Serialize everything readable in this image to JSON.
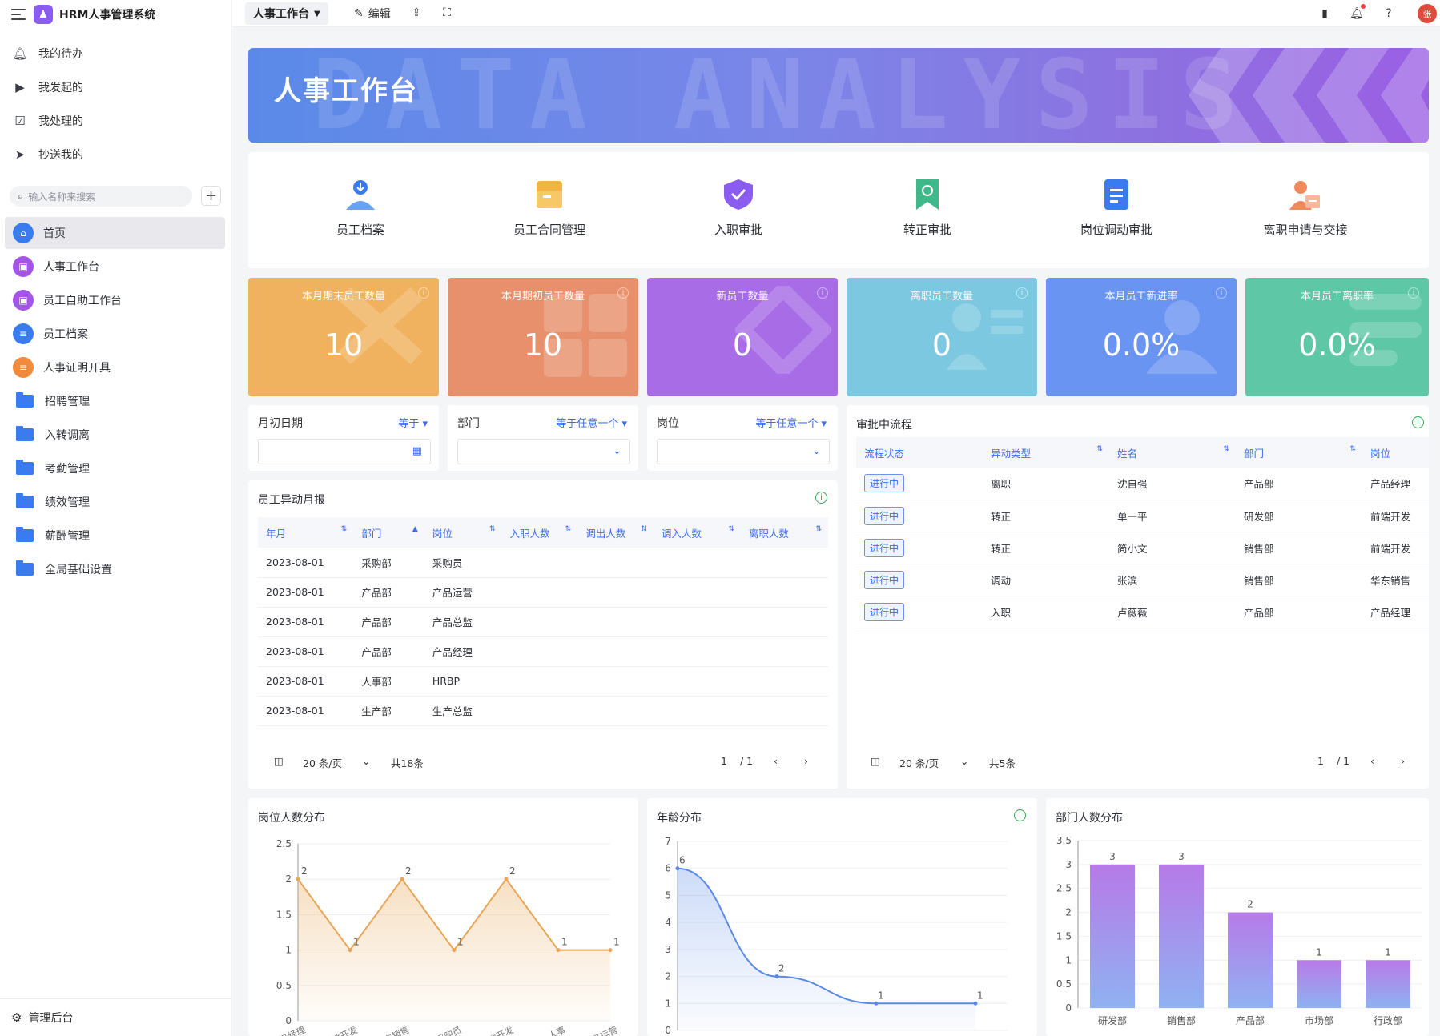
{
  "app": {
    "name": "HRM人事管理系统"
  },
  "sidebar": {
    "todo": [
      {
        "label": "我的待办",
        "icon": "bell-icon"
      },
      {
        "label": "我发起的",
        "icon": "play-circle-icon"
      },
      {
        "label": "我处理的",
        "icon": "check-box-icon"
      },
      {
        "label": "抄送我的",
        "icon": "send-icon"
      }
    ],
    "search_placeholder": "输入名称来搜索",
    "nav": [
      {
        "label": "首页",
        "icon": "home-icon",
        "color": "#3a7cf0",
        "active": true
      },
      {
        "label": "人事工作台",
        "icon": "workbench-icon",
        "color": "#a355e6"
      },
      {
        "label": "员工自助工作台",
        "icon": "self-service-icon",
        "color": "#a355e6"
      },
      {
        "label": "员工档案",
        "icon": "file-icon",
        "color": "#3a7cf0"
      },
      {
        "label": "人事证明开具",
        "icon": "certificate-icon",
        "color": "#f08a3c"
      },
      {
        "label": "招聘管理",
        "icon": "folder-icon"
      },
      {
        "label": "入转调离",
        "icon": "folder-icon"
      },
      {
        "label": "考勤管理",
        "icon": "folder-icon"
      },
      {
        "label": "绩效管理",
        "icon": "folder-icon"
      },
      {
        "label": "薪酬管理",
        "icon": "folder-icon"
      },
      {
        "label": "全局基础设置",
        "icon": "folder-icon"
      }
    ],
    "admin": "管理后台"
  },
  "topbar": {
    "current_tab": "人事工作台",
    "edit": "编辑",
    "avatar_text": "张"
  },
  "banner": {
    "title": "人事工作台",
    "bg_text": "DATA ANALYSIS"
  },
  "quick": [
    {
      "label": "员工档案",
      "color": "#3a7cf0"
    },
    {
      "label": "员工合同管理",
      "color": "#f2b443"
    },
    {
      "label": "入职审批",
      "color": "#8a5cf0"
    },
    {
      "label": "转正审批",
      "color": "#3fb98a"
    },
    {
      "label": "岗位调动审批",
      "color": "#3a7cf0"
    },
    {
      "label": "离职申请与交接",
      "color": "#f08a5c"
    }
  ],
  "kpis": [
    {
      "title": "本月期末员工数量",
      "value": "10",
      "color": "#f0b25e"
    },
    {
      "title": "本月期初员工数量",
      "value": "10",
      "color": "#e8906c"
    },
    {
      "title": "新员工数量",
      "value": "0",
      "color": "#a86ce6"
    },
    {
      "title": "离职员工数量",
      "value": "0",
      "color": "#7cc8e0"
    },
    {
      "title": "本月员工新进率",
      "value": "0.0%",
      "color": "#6a94f2"
    },
    {
      "title": "本月员工离职率",
      "value": "0.0%",
      "color": "#5ec8a6"
    }
  ],
  "filters": [
    {
      "label": "月初日期",
      "op": "等于",
      "icon": "calendar-icon"
    },
    {
      "label": "部门",
      "op": "等于任意一个",
      "icon": "chevron-down-icon"
    },
    {
      "label": "岗位",
      "op": "等于任意一个",
      "icon": "chevron-down-icon"
    }
  ],
  "monthly_report": {
    "title": "员工异动月报",
    "columns": [
      "年月",
      "部门",
      "岗位",
      "入职人数",
      "调出人数",
      "调入人数",
      "离职人数"
    ],
    "rows": [
      [
        "2023-08-01",
        "采购部",
        "采购员"
      ],
      [
        "2023-08-01",
        "产品部",
        "产品运营"
      ],
      [
        "2023-08-01",
        "产品部",
        "产品总监"
      ],
      [
        "2023-08-01",
        "产品部",
        "产品经理"
      ],
      [
        "2023-08-01",
        "人事部",
        "HRBP"
      ],
      [
        "2023-08-01",
        "生产部",
        "生产总监"
      ]
    ],
    "page_size": "20 条/页",
    "total": "共18条",
    "page": "1",
    "pages": "/ 1"
  },
  "approvals": {
    "title": "审批中流程",
    "columns": [
      "流程状态",
      "异动类型",
      "姓名",
      "部门",
      "岗位"
    ],
    "rows": [
      [
        "进行中",
        "离职",
        "沈自强",
        "产品部",
        "产品经理"
      ],
      [
        "进行中",
        "转正",
        "单一平",
        "研发部",
        "前端开发"
      ],
      [
        "进行中",
        "转正",
        "简小文",
        "销售部",
        "前端开发"
      ],
      [
        "进行中",
        "调动",
        "张滨",
        "销售部",
        "华东销售"
      ],
      [
        "进行中",
        "入职",
        "卢薇薇",
        "产品部",
        "产品经理"
      ]
    ],
    "page_size": "20 条/页",
    "total": "共5条",
    "page": "1",
    "pages": "/ 1"
  },
  "chart_data": [
    {
      "type": "area",
      "title": "岗位人数分布",
      "values": [
        2,
        1,
        2,
        1,
        2,
        1,
        1
      ],
      "categories": [
        "产品经理",
        "前端开发",
        "华东销售",
        "采购员",
        "后端开发",
        "人事",
        "产品运营"
      ],
      "ylim": [
        0,
        2.5
      ],
      "yticks": [
        0,
        0.5,
        1,
        1.5,
        2,
        2.5
      ],
      "color": "#e8a656"
    },
    {
      "type": "area",
      "title": "年龄分布",
      "values": [
        6,
        2,
        1,
        1
      ],
      "ylim": [
        0,
        7
      ],
      "yticks": [
        0,
        1,
        2,
        3,
        4,
        5,
        6,
        7
      ],
      "color": "#5a8ae8"
    },
    {
      "type": "bar",
      "title": "部门人数分布",
      "categories": [
        "研发部",
        "销售部",
        "产品部",
        "市场部",
        "行政部"
      ],
      "values": [
        3,
        3,
        2,
        1,
        1
      ],
      "ylim": [
        0,
        3.5
      ],
      "yticks": [
        0,
        0.5,
        1,
        1.5,
        2,
        2.5,
        3,
        3.5
      ]
    }
  ]
}
